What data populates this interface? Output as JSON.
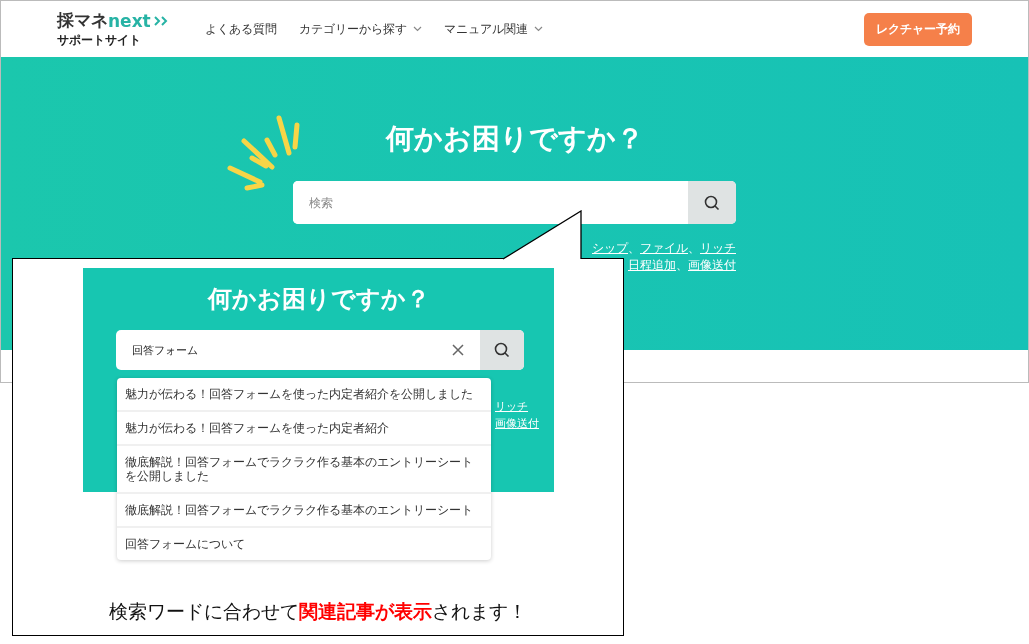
{
  "header": {
    "logo": {
      "main": "採マネ",
      "accent": "next",
      "sub": "サポートサイト"
    },
    "nav": [
      {
        "label": "よくある質問",
        "dropdown": false
      },
      {
        "label": "カテゴリーから探す",
        "dropdown": true
      },
      {
        "label": "マニュアル関連",
        "dropdown": true
      }
    ],
    "cta": "レクチャー予約"
  },
  "hero": {
    "title": "何かお困りですか？",
    "search": {
      "placeholder": "検索"
    },
    "keyword_lines": [
      [
        {
          "kind": "link",
          "text": "シップ"
        },
        {
          "kind": "sep",
          "text": "、"
        },
        {
          "kind": "link",
          "text": "ファイル"
        },
        {
          "kind": "sep",
          "text": "、"
        },
        {
          "kind": "link",
          "text": "リッチ"
        }
      ],
      [
        {
          "kind": "link",
          "text": "日程追加"
        },
        {
          "kind": "sep",
          "text": "、"
        },
        {
          "kind": "link",
          "text": "画像送付"
        }
      ]
    ]
  },
  "callout": {
    "title": "何かお困りですか？",
    "search": {
      "value": "回答フォーム"
    },
    "keyword_lines": [
      [
        {
          "kind": "link",
          "text": "リッチ"
        }
      ],
      [
        {
          "kind": "link",
          "text": "画像送付"
        }
      ]
    ],
    "suggestions": [
      "魅力が伝わる！回答フォームを使った内定者紹介を公開しました",
      "魅力が伝わる！回答フォームを使った内定者紹介",
      "徹底解説！回答フォームでラクラク作る基本のエントリーシートを公開しました",
      "徹底解説！回答フォームでラクラク作る基本のエントリーシート",
      "回答フォームについて"
    ],
    "caption": "検索ワードに合わせて**関連記事が表示**されます！"
  }
}
